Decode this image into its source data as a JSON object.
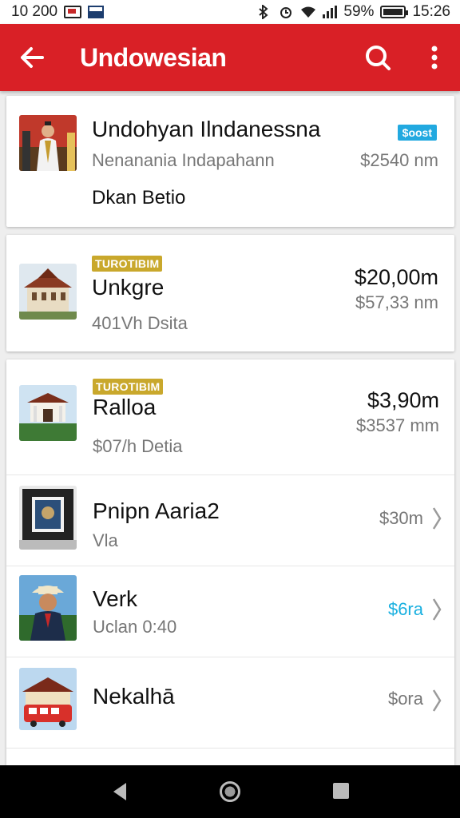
{
  "status_bar": {
    "left_text": "10 200",
    "battery": "59%",
    "time": "15:26"
  },
  "app_bar": {
    "title": "Undowesian",
    "back_icon": "arrow-back-icon",
    "search_icon": "search-icon",
    "more_icon": "more-vert-icon",
    "color": "#d92026"
  },
  "cards": [
    {
      "title": "Undohyan Ilndanessna",
      "subtitle": "Nenanania Indapahann",
      "extra": "Dkan Betio",
      "badge": "$oost",
      "price_sub": "$2540 nm"
    },
    {
      "badge": "TUROTIBIM",
      "title": "Unkgre",
      "subtitle": "401Vh Dsita",
      "price_main": "$20,00m",
      "price_sub": "$57,33 nm"
    }
  ],
  "list": [
    {
      "badge": "TUROTIBIM",
      "title": "Ralloa",
      "subtitle": "$07/h Detia",
      "price_main": "$3,90m",
      "price_sub": "$3537 mm"
    },
    {
      "title": "Pnipn Aaria2",
      "subtitle": "Vla",
      "price": "$30m"
    },
    {
      "title": "Verk",
      "subtitle": "Uclan 0:40",
      "price": "$6ra"
    },
    {
      "title": "Nekalhā",
      "subtitle": "",
      "price": "$ora"
    }
  ],
  "colors": {
    "accent_blue": "#1ab0e0",
    "badge_yellow": "#c9a82c",
    "badge_blue": "#22a9e0"
  }
}
